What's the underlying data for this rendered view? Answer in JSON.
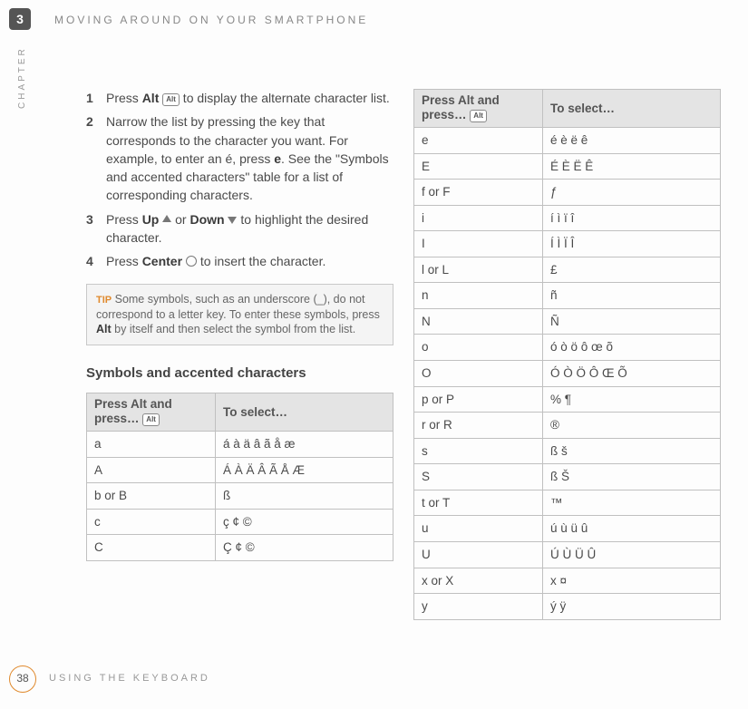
{
  "chapter_badge": "3",
  "chapter_label": "CHAPTER",
  "running_head": "MOVING AROUND ON YOUR SMARTPHONE",
  "steps": [
    {
      "n": "1",
      "parts": [
        "Press ",
        {
          "b": "Alt"
        },
        " ",
        {
          "key": "Alt"
        },
        " to display the alternate character list."
      ]
    },
    {
      "n": "2",
      "parts": [
        "Narrow the list by pressing the key that corresponds to the character you want. For example, to enter an é, press ",
        {
          "b": "e"
        },
        ". See the \"Symbols and accented characters\" table for a list of corresponding characters."
      ]
    },
    {
      "n": "3",
      "parts": [
        "Press ",
        {
          "b": "Up"
        },
        " ",
        {
          "icon": "up"
        },
        " or ",
        {
          "b": "Down"
        },
        " ",
        {
          "icon": "down"
        },
        " to highlight the desired character."
      ]
    },
    {
      "n": "4",
      "parts": [
        "Press ",
        {
          "b": "Center"
        },
        " ",
        {
          "icon": "circle"
        },
        " to insert the character."
      ]
    }
  ],
  "tip": {
    "label": "TIP",
    "text": "Some symbols, such as an underscore (_), do not correspond to a letter key. To enter these symbols, press Alt by itself and then select the symbol from the list.",
    "bold_word": "Alt"
  },
  "subheading": "Symbols and accented characters",
  "table_header": {
    "c1": "Press Alt and press…",
    "c2": "To select…"
  },
  "table_left": [
    {
      "k": "a",
      "v": "á à ä â ã å æ"
    },
    {
      "k": "A",
      "v": "Á À Ä Â Ã Å Æ"
    },
    {
      "k": "b or B",
      "v": "ß"
    },
    {
      "k": "c",
      "v": "ç ¢ ©"
    },
    {
      "k": "C",
      "v": "Ç ¢ ©"
    }
  ],
  "table_right": [
    {
      "k": "e",
      "v": "é è ë ê"
    },
    {
      "k": "E",
      "v": "É È Ë Ê"
    },
    {
      "k": "f or F",
      "v": "ƒ"
    },
    {
      "k": "i",
      "v": "í ì ï î"
    },
    {
      "k": "I",
      "v": "Í Ì Ï Î"
    },
    {
      "k": "l or L",
      "v": "£"
    },
    {
      "k": "n",
      "v": "ñ"
    },
    {
      "k": "N",
      "v": "Ñ"
    },
    {
      "k": "o",
      "v": "ó ò ö ô œ õ"
    },
    {
      "k": "O",
      "v": "Ó Ò Ö Ô Œ Õ"
    },
    {
      "k": "p or P",
      "v": "% ¶"
    },
    {
      "k": "r or R",
      "v": "®"
    },
    {
      "k": "s",
      "v": "ß š"
    },
    {
      "k": "S",
      "v": "ß Š"
    },
    {
      "k": "t or T",
      "v": "™"
    },
    {
      "k": "u",
      "v": "ú ù ü û"
    },
    {
      "k": "U",
      "v": "Ú Ù Ü Û"
    },
    {
      "k": "x or X",
      "v": "x ¤"
    },
    {
      "k": "y",
      "v": "ý ÿ"
    }
  ],
  "footer": {
    "page": "38",
    "text": "USING THE KEYBOARD"
  }
}
